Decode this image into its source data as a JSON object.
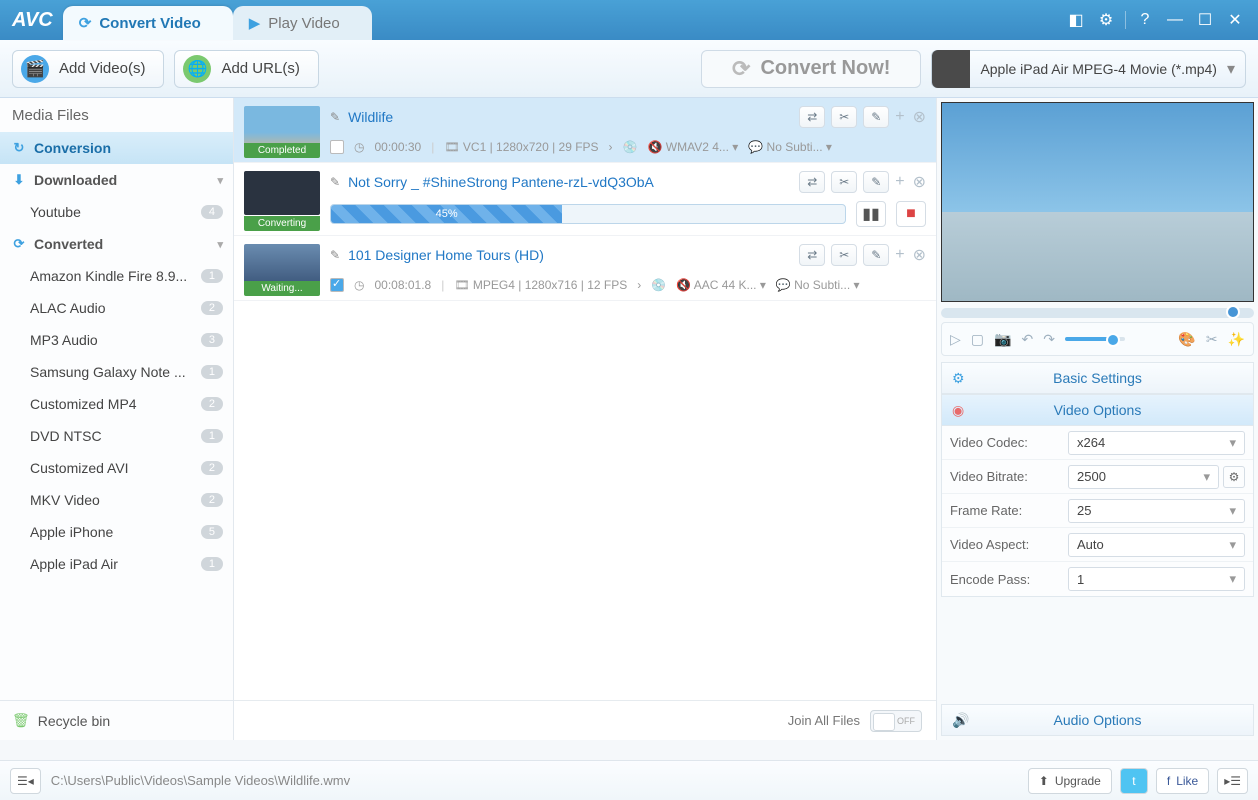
{
  "app": {
    "name": "AVC"
  },
  "tabs": {
    "convert": "Convert Video",
    "play": "Play Video"
  },
  "toolbar": {
    "add_video": "Add Video(s)",
    "add_url": "Add URL(s)",
    "convert_now": "Convert Now!",
    "profile": "Apple iPad Air MPEG-4 Movie (*.mp4)"
  },
  "sidebar": {
    "header": "Media Files",
    "conversion": "Conversion",
    "downloaded": "Downloaded",
    "converted": "Converted",
    "items_dl": [
      {
        "label": "Youtube",
        "count": "4"
      }
    ],
    "items_cv": [
      {
        "label": "Amazon Kindle Fire 8.9...",
        "count": "1"
      },
      {
        "label": "ALAC Audio",
        "count": "2"
      },
      {
        "label": "MP3 Audio",
        "count": "3"
      },
      {
        "label": "Samsung Galaxy Note ...",
        "count": "1"
      },
      {
        "label": "Customized MP4",
        "count": "2"
      },
      {
        "label": "DVD NTSC",
        "count": "1"
      },
      {
        "label": "Customized AVI",
        "count": "2"
      },
      {
        "label": "MKV Video",
        "count": "2"
      },
      {
        "label": "Apple iPhone",
        "count": "5"
      },
      {
        "label": "Apple iPad Air",
        "count": "1"
      }
    ],
    "recycle": "Recycle bin"
  },
  "files": [
    {
      "title": "Wildlife",
      "status": "Completed",
      "selected": true,
      "duration": "00:00:30",
      "vinfo": "VC1 | 1280x720 | 29 FPS",
      "audio": "WMAV2 4...",
      "subtitle": "No Subti..."
    },
    {
      "title": "Not Sorry _ #ShineStrong Pantene-rzL-vdQ3ObA",
      "status": "Converting",
      "progress": "45%",
      "progress_pct": 45
    },
    {
      "title": "101 Designer Home Tours (HD)",
      "status": "Waiting...",
      "duration": "00:08:01.8",
      "vinfo": "MPEG4 | 1280x716 | 12 FPS",
      "audio": "AAC 44 K...",
      "subtitle": "No Subti...",
      "checked": true
    }
  ],
  "join": {
    "label": "Join All Files",
    "toggle": "OFF"
  },
  "settings": {
    "basic": "Basic Settings",
    "video": "Video Options",
    "audio": "Audio Options",
    "rows": [
      {
        "label": "Video Codec:",
        "value": "x264"
      },
      {
        "label": "Video Bitrate:",
        "value": "2500",
        "gear": true
      },
      {
        "label": "Frame Rate:",
        "value": "25"
      },
      {
        "label": "Video Aspect:",
        "value": "Auto"
      },
      {
        "label": "Encode Pass:",
        "value": "1"
      }
    ]
  },
  "footer": {
    "path": "C:\\Users\\Public\\Videos\\Sample Videos\\Wildlife.wmv",
    "upgrade": "Upgrade",
    "like": "Like"
  }
}
